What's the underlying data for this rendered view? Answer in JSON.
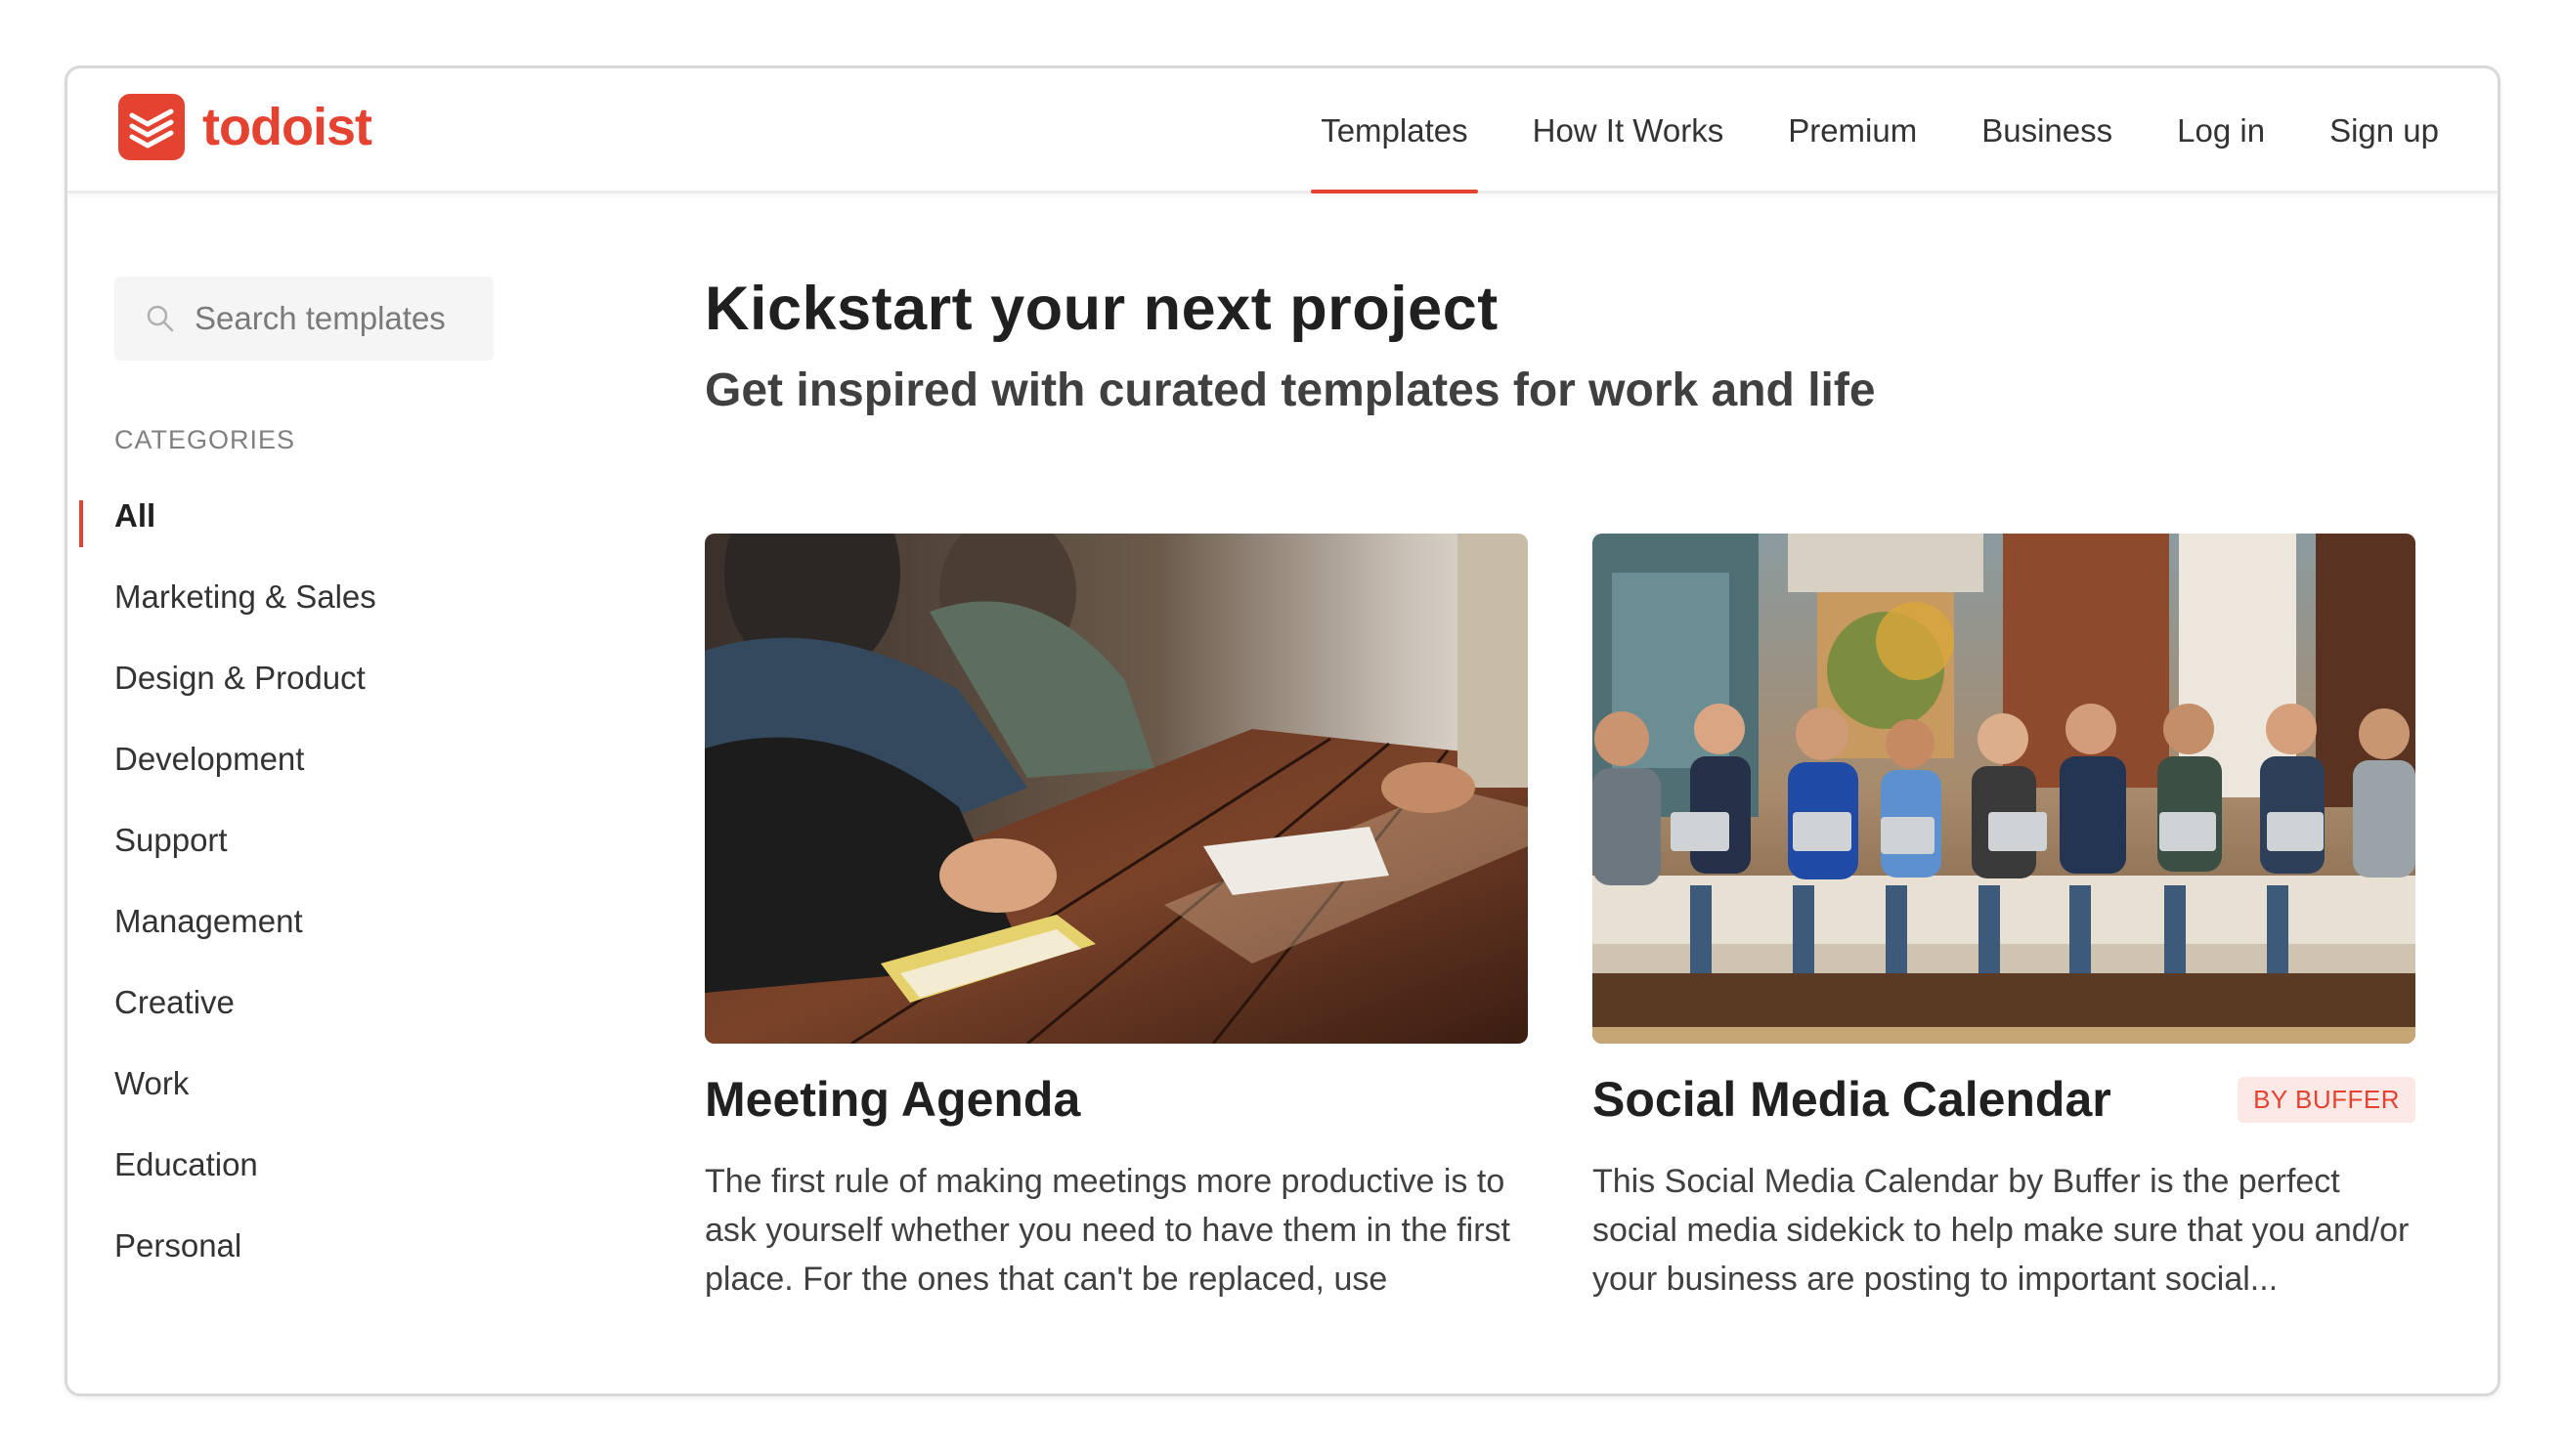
{
  "brand": {
    "name": "todoist",
    "color": "#e44332"
  },
  "nav": {
    "items": [
      {
        "label": "Templates",
        "active": true
      },
      {
        "label": "How It Works",
        "active": false
      },
      {
        "label": "Premium",
        "active": false
      },
      {
        "label": "Business",
        "active": false
      },
      {
        "label": "Log in",
        "active": false
      },
      {
        "label": "Sign up",
        "active": false
      }
    ]
  },
  "sidebar": {
    "search": {
      "placeholder": "Search templates",
      "icon": "search-icon"
    },
    "categories_heading": "CATEGORIES",
    "categories": [
      {
        "label": "All",
        "active": true
      },
      {
        "label": "Marketing & Sales"
      },
      {
        "label": "Design & Product"
      },
      {
        "label": "Development"
      },
      {
        "label": "Support"
      },
      {
        "label": "Management"
      },
      {
        "label": "Creative"
      },
      {
        "label": "Work"
      },
      {
        "label": "Education"
      },
      {
        "label": "Personal"
      }
    ]
  },
  "main": {
    "title": "Kickstart your next project",
    "subtitle": "Get inspired with curated templates for work and life",
    "cards": [
      {
        "title": "Meeting Agenda",
        "badge": "",
        "description": "The first rule of making meetings more productive is to ask yourself whether you need to have them in the first place. For the ones that can't be replaced, use",
        "image": "meeting-photo"
      },
      {
        "title": "Social Media Calendar",
        "badge": "BY BUFFER",
        "description": "This Social Media Calendar by Buffer is the perfect social media sidekick to help make sure that you and/or your business are posting to important social...",
        "image": "team-photo"
      }
    ]
  }
}
